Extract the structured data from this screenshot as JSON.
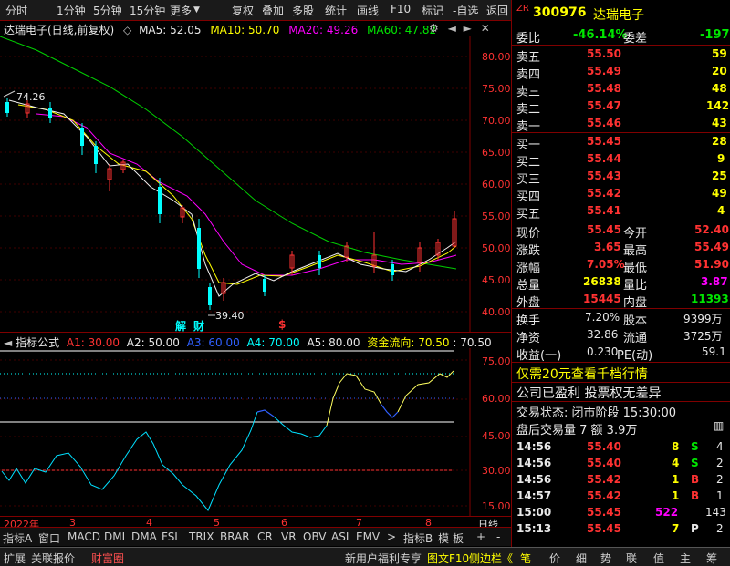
{
  "toolbar": {
    "left": [
      "分时",
      "1分钟",
      "5分钟",
      "15分钟",
      "更多"
    ],
    "right": [
      "复权",
      "叠加",
      "多股",
      "统计",
      "画线",
      "F10",
      "标记",
      "-自选",
      "返回"
    ]
  },
  "chart_header": {
    "title": "达瑞电子(日线,前复权)",
    "ma5": "MA5: 52.05",
    "ma10": "MA10: 50.70",
    "ma20": "MA20: 49.26",
    "ma60": "MA60: 47.82"
  },
  "annotations": {
    "high": "74.26",
    "low": "39.40",
    "jie": "解",
    "cai": "财",
    "dollar": "$"
  },
  "price_axis": [
    "80.00",
    "75.00",
    "70.00",
    "65.00",
    "60.00",
    "55.00",
    "50.00",
    "45.00",
    "40.00"
  ],
  "indicator_header": {
    "name": "指标公式",
    "a1": "A1: 30.00",
    "a2": "A2: 50.00",
    "a3": "A3: 60.00",
    "a4": "A4: 70.00",
    "a5": "A5: 80.00",
    "flow": "资金流向: 70.50",
    "flow2": ": 70.50"
  },
  "indicator_axis": [
    "75.00",
    "60.00",
    "45.00",
    "30.00",
    "15.00"
  ],
  "months": [
    "2022年",
    "3",
    "4",
    "5",
    "6",
    "7",
    "8"
  ],
  "period": "日线",
  "indicator_tabs": [
    "指标A",
    "窗口",
    "MACD",
    "DMI",
    "DMA",
    "FSL",
    "TRIX",
    "BRAR",
    "CR",
    "VR",
    "OBV",
    "ASI",
    "EMV",
    "指标B",
    "模",
    "板",
    "+",
    "-"
  ],
  "bottom_tabs": [
    "扩展",
    "关联报价",
    "财富圈"
  ],
  "bottom_right": [
    "新用户福利专享",
    "图文F10",
    "侧边栏《"
  ],
  "bottom_icons": [
    "笔",
    "价",
    "细",
    "势",
    "联",
    "值",
    "主",
    "筹"
  ],
  "stock": {
    "code": "300976",
    "name": "达瑞电子",
    "tag": "ZR"
  },
  "weibi": {
    "label": "委比",
    "value": "-46.14%",
    "label2": "委差",
    "value2": "-197"
  },
  "asks": [
    {
      "label": "卖五",
      "price": "55.50",
      "vol": "59"
    },
    {
      "label": "卖四",
      "price": "55.49",
      "vol": "20"
    },
    {
      "label": "卖三",
      "price": "55.48",
      "vol": "48"
    },
    {
      "label": "卖二",
      "price": "55.47",
      "vol": "142"
    },
    {
      "label": "卖一",
      "price": "55.46",
      "vol": "43"
    }
  ],
  "bids": [
    {
      "label": "买一",
      "price": "55.45",
      "vol": "28"
    },
    {
      "label": "买二",
      "price": "55.44",
      "vol": "9"
    },
    {
      "label": "买三",
      "price": "55.43",
      "vol": "25"
    },
    {
      "label": "买四",
      "price": "55.42",
      "vol": "49"
    },
    {
      "label": "买五",
      "price": "55.41",
      "vol": "4"
    }
  ],
  "quote": [
    {
      "l1": "现价",
      "v1": "55.45",
      "l2": "今开",
      "v2": "52.40"
    },
    {
      "l1": "涨跌",
      "v1": "3.65",
      "l2": "最高",
      "v2": "55.49"
    },
    {
      "l1": "涨幅",
      "v1": "7.05%",
      "l2": "最低",
      "v2": "51.90"
    },
    {
      "l1": "总量",
      "v1": "26838",
      "l2": "量比",
      "v2": "3.87"
    },
    {
      "l1": "外盘",
      "v1": "15445",
      "l2": "内盘",
      "v2": "11393"
    }
  ],
  "stats": [
    {
      "l1": "换手",
      "v1": "7.20%",
      "l2": "股本",
      "v2": "9399万"
    },
    {
      "l1": "净资",
      "v1": "32.86",
      "l2": "流通",
      "v2": "3725万"
    },
    {
      "l1": "收益(一)",
      "v1": "0.230",
      "l2": "PE(动)",
      "v2": "59.1"
    }
  ],
  "promo": "仅需20元查看千档行情",
  "notice": "公司已盈利 投票权无差异",
  "trade_state": "交易状态: 闭市阶段 15:30:00",
  "after_hours": "盘后交易量 7 额 3.9万",
  "ticks": [
    {
      "t": "14:56",
      "p": "55.40",
      "v": "8",
      "s": "S"
    },
    {
      "t": "14:56",
      "p": "55.40",
      "v": "4",
      "s": "S"
    },
    {
      "t": "14:56",
      "p": "55.42",
      "v": "1",
      "s": "B"
    },
    {
      "t": "14:57",
      "p": "55.42",
      "v": "1",
      "s": "B"
    },
    {
      "t": "15:00",
      "p": "55.45",
      "v": "522",
      "s": "143"
    },
    {
      "t": "15:13",
      "p": "55.45",
      "v": "7",
      "s": "P"
    }
  ],
  "ticks_extra": [
    "4",
    "2",
    "2",
    "1",
    "",
    "2"
  ],
  "colors": {
    "up": "#ff3232",
    "down": "#00e600",
    "ma5": "#ffffff",
    "ma10": "#ffff00",
    "ma20": "#ff00ff",
    "ma60": "#00e600",
    "panel_border": "#800000"
  }
}
